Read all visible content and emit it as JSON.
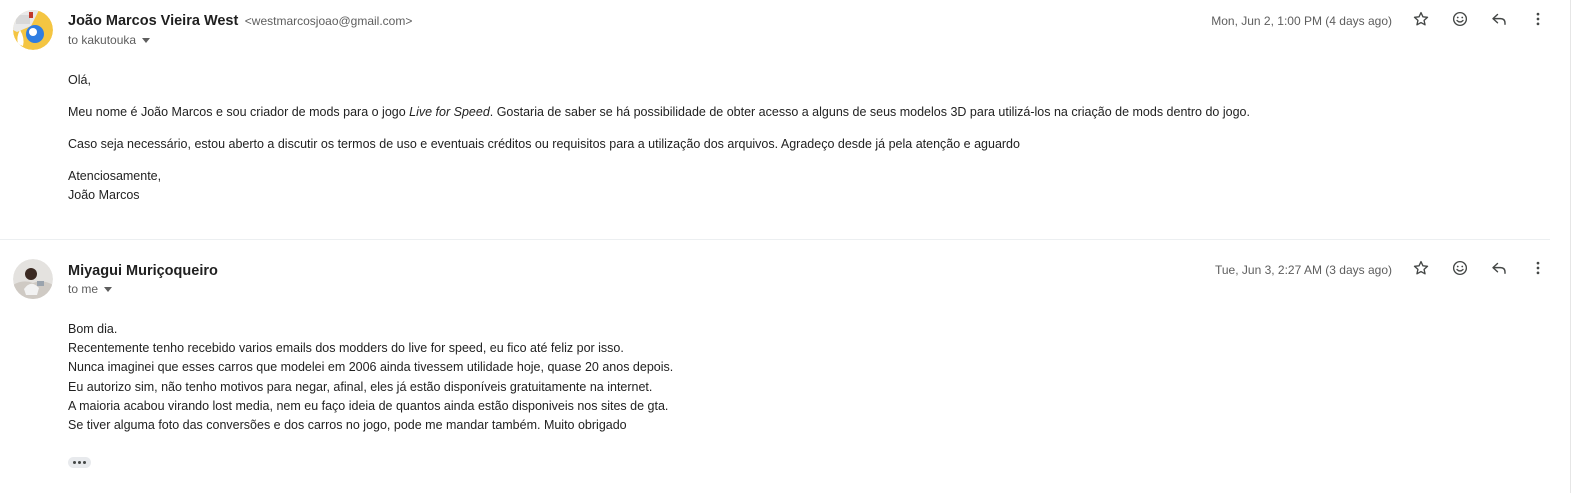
{
  "messages": [
    {
      "sender_name": "João Marcos Vieira West",
      "sender_email": "<westmarcosjoao@gmail.com>",
      "recipient": "to kakutouka",
      "date": "Mon, Jun 2, 1:00 PM (4 days ago)",
      "body": {
        "greeting": "Olá,",
        "p1_before": "Meu nome é João Marcos e sou criador de mods para o jogo ",
        "p1_italic": "Live for Speed",
        "p1_after": ". Gostaria de saber se há possibilidade de obter acesso a alguns de seus modelos 3D para utilizá-los na criação de mods dentro do jogo.",
        "p2": "Caso seja necessário, estou aberto a discutir os termos de uso e eventuais créditos ou requisitos para a utilização dos arquivos. Agradeço desde já pela atenção e aguardo",
        "closing": "Atenciosamente,",
        "signature": "João Marcos"
      }
    },
    {
      "sender_name": "Miyagui Muriçoqueiro",
      "recipient": "to me",
      "date": "Tue, Jun 3, 2:27 AM (3 days ago)",
      "body_lines": [
        "Bom dia.",
        "Recentemente tenho recebido varios emails dos modders do live for speed, eu fico até feliz por isso.",
        "Nunca imaginei que esses carros que modelei em 2006 ainda tivessem utilidade hoje, quase 20 anos depois.",
        "Eu autorizo sim, não tenho motivos para negar, afinal, eles já estão disponíveis gratuitamente  na internet.",
        "A maioria acabou virando lost media, nem eu faço ideia de quantos ainda estão disponiveis nos sites de gta.",
        "Se tiver alguma foto das conversões e dos carros no jogo, pode me mandar também. Muito obrigado"
      ]
    }
  ],
  "icons": {
    "star": "star-icon",
    "emoji": "add-reaction-icon",
    "reply": "reply-icon",
    "more": "more-vert-icon",
    "trimmed": "show-trimmed-content-icon"
  },
  "colors": {
    "text": "#1f1f1f",
    "muted": "#5e5e5e",
    "icon": "#444746",
    "divider": "#eceff1"
  }
}
